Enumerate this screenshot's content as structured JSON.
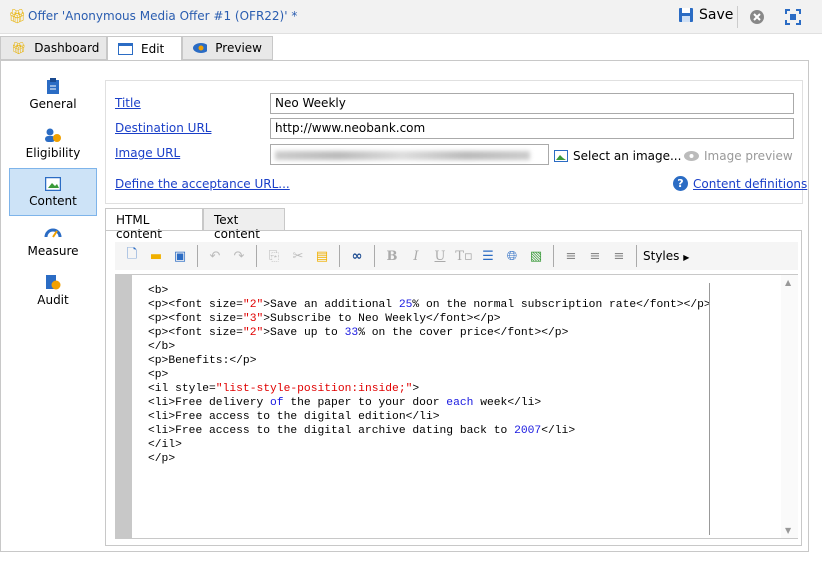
{
  "window": {
    "title": "Offer 'Anonymous Media Offer #1 (OFR22)' *",
    "save_label": "Save"
  },
  "tabs": [
    {
      "label": "Dashboard"
    },
    {
      "label": "Edit"
    },
    {
      "label": "Preview"
    }
  ],
  "nav": [
    {
      "label": "General"
    },
    {
      "label": "Eligibility"
    },
    {
      "label": "Content"
    },
    {
      "label": "Measure"
    },
    {
      "label": "Audit"
    }
  ],
  "form": {
    "title_label": "Title",
    "title_value": "Neo Weekly",
    "dest_label": "Destination URL",
    "dest_value": "http://www.neobank.com",
    "image_label": "Image URL",
    "select_image": "Select an image...",
    "image_preview": "Image preview",
    "accept_url": "Define the acceptance URL...",
    "content_defs": "Content definitions"
  },
  "editor_tabs": [
    {
      "label": "HTML content"
    },
    {
      "label": "Text content"
    }
  ],
  "toolbar": {
    "styles_label": "Styles"
  },
  "colors": {
    "tag": "#000000",
    "string": "#e00000",
    "keyword": "#1a1ae0"
  },
  "code_lines": [
    [
      [
        "<b>",
        "t"
      ]
    ],
    [
      [
        "<p><font size=",
        "t"
      ],
      [
        "\"2\"",
        "s"
      ],
      [
        ">Save an additional ",
        "t"
      ],
      [
        "25",
        "k"
      ],
      [
        "% on the normal subscription rate</font></p>",
        "t"
      ]
    ],
    [
      [
        "<p><font size=",
        "t"
      ],
      [
        "\"3\"",
        "s"
      ],
      [
        ">Subscribe to Neo Weekly</font></p>",
        "t"
      ]
    ],
    [
      [
        "<p><font size=",
        "t"
      ],
      [
        "\"2\"",
        "s"
      ],
      [
        ">Save up to ",
        "t"
      ],
      [
        "33",
        "k"
      ],
      [
        "% on the cover price</font></p>",
        "t"
      ]
    ],
    [
      [
        "</b>",
        "t"
      ]
    ],
    [
      [
        "<p>Benefits:</p>",
        "t"
      ]
    ],
    [
      [
        "<p>",
        "t"
      ]
    ],
    [
      [
        "<il style=",
        "t"
      ],
      [
        "\"list-style-position:inside;\"",
        "s"
      ],
      [
        ">",
        "t"
      ]
    ],
    [
      [
        "<li>Free delivery ",
        "t"
      ],
      [
        "of",
        "k"
      ],
      [
        " the paper to your door ",
        "t"
      ],
      [
        "each",
        "k"
      ],
      [
        " week</li>",
        "t"
      ]
    ],
    [
      [
        "<li>Free access to the digital edition</li>",
        "t"
      ]
    ],
    [
      [
        "<li>Free access to the digital archive dating back to ",
        "t"
      ],
      [
        "2007",
        "k"
      ],
      [
        "</li>",
        "t"
      ]
    ],
    [
      [
        "</il>",
        "t"
      ]
    ],
    [
      [
        "</p>",
        "t"
      ]
    ]
  ]
}
